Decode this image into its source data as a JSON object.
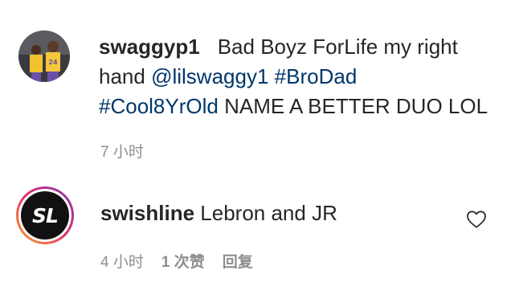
{
  "comments": [
    {
      "username": "swaggyp1",
      "text_line1": "Bad Boyz ForLife my right",
      "text_line2_prefix": "hand ",
      "mention": "@lilswaggy1",
      "hashtag1": "#BroDad",
      "hashtag2": "#Cool8YrOld",
      "text_line3_suffix": " NAME A BETTER DUO LOL",
      "time": "7 小时"
    },
    {
      "username": "swishline",
      "avatar_logo": "SL",
      "text": "Lebron and JR",
      "time": "4 小时",
      "likes": "1 次赞",
      "reply": "回复",
      "like_icon": "heart-outline-icon"
    }
  ],
  "colors": {
    "text": "#262626",
    "link": "#00376b",
    "meta": "#8e8e8e"
  }
}
